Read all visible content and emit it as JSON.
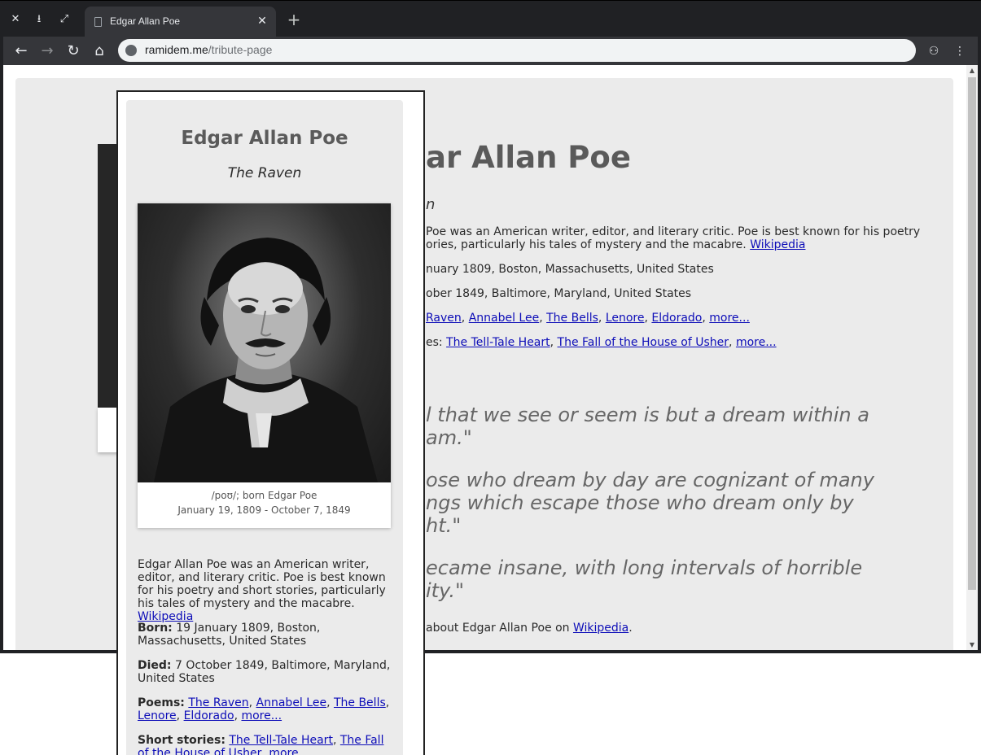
{
  "browser": {
    "tab_title": "Edgar Allan Poe",
    "url_host": "ramidem.me",
    "url_path": "/tribute-page",
    "icons": {
      "close_window": "close-icon",
      "download": "download-icon",
      "fullscreen": "expand-icon",
      "back": "arrow-left-icon",
      "forward": "arrow-right-icon",
      "reload": "reload-icon",
      "home": "home-icon",
      "incognito": "incognito-icon",
      "menu": "kebab-menu-icon"
    }
  },
  "page": {
    "title": "Edgar Allan Poe",
    "subtitle": "The Raven",
    "caption_pronunciation": "/poʊ/; born Edgar Poe",
    "caption_dates": "January 19, 1809 - October 7, 1849",
    "bio": "Edgar Allan Poe was an American writer, editor, and literary critic. Poe is best known for his poetry and short stories, particularly his tales of mystery and the macabre.",
    "bio_link": "Wikipedia",
    "born_label": "Born:",
    "born": "19 January 1809, Boston, Massachusetts, United States",
    "died_label": "Died:",
    "died": "7 October 1849, Baltimore, Maryland, United States",
    "poems_label": "Poems:",
    "poems": [
      "The Raven",
      "Annabel Lee",
      "The Bells",
      "Lenore",
      "Eldorado",
      "more..."
    ],
    "stories_label": "Short stories:",
    "stories": [
      "The Tell-Tale Heart",
      "The Fall of the House of Usher",
      "more..."
    ],
    "quotes": [
      "\"All that we see or seem is but a dream within a dream.\"",
      "\"Those who dream by day are cognizant of many things which escape those who dream only by night.\"",
      "\"I became insane, with long intervals of horrible sanity.\""
    ],
    "more_info_prefix": "Read more about Edgar Allan Poe on",
    "more_info_link": "Wikipedia"
  },
  "desktop_visible": {
    "title": "ar Allan Poe",
    "subtitle": "n",
    "bio_line1": "Poe was an American writer, editor, and literary critic. Poe is best known for his poetry",
    "bio_line2": "ories, particularly his tales of mystery and the macabre.",
    "born_line": "nuary 1809, Boston, Massachusetts, United States",
    "died_line": "ober 1849, Baltimore, Maryland, United States",
    "poems_first": "Raven",
    "stories_prefix": "es:",
    "quote1_line1": "l that we see or seem is but a dream within a",
    "quote1_line2": "am.\"",
    "quote2_line1": "ose who dream by day are cognizant of many",
    "quote2_line2": "ngs which escape those who dream only by",
    "quote2_line3": "ht.\"",
    "quote3_line1": "ecame insane, with long intervals of horrible",
    "quote3_line2": "ity.\"",
    "more_info_prefix": "about Edgar Allan Poe on"
  }
}
